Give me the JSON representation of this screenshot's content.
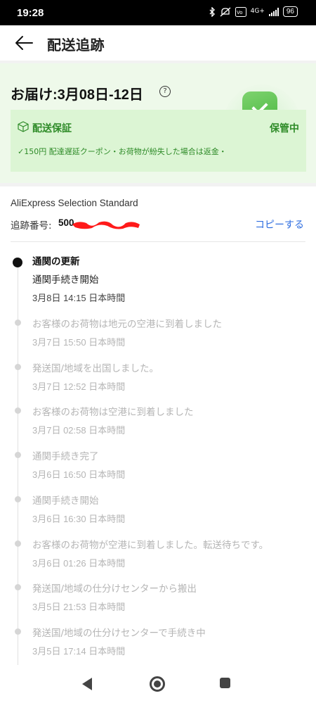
{
  "status_bar": {
    "time": "19:28",
    "network": "4G+",
    "battery": "96",
    "icons": [
      "bluetooth-icon",
      "mute-icon",
      "volte-icon",
      "signal-icon",
      "battery-icon"
    ]
  },
  "header": {
    "title": "配送追跡",
    "back_icon": "arrow-left-icon"
  },
  "delivery": {
    "eta": "お届け:3月08日-12日",
    "help_icon": "?",
    "guarantee_label": "配送保証",
    "guarantee_status": "保管中",
    "guarantee_note": "✓150円 配達遅延クーポン・お荷物が紛失した場合は返金・",
    "accent_color": "#2e8b28"
  },
  "tracking": {
    "carrier": "AliExpress Selection Standard",
    "number_label": "追跡番号:",
    "number_visible": "500",
    "copy_label": "コピーする",
    "events": [
      {
        "title": "通関の更新",
        "subtitle": "通関手続き開始",
        "time": "3月8日 14:15 日本時間",
        "active": true
      },
      {
        "title": "お客様のお荷物は地元の空港に到着しました",
        "time": "3月7日 15:50 日本時間"
      },
      {
        "title": "発送国/地域を出国しました。",
        "time": "3月7日 12:52 日本時間"
      },
      {
        "title": "お客様のお荷物は空港に到着しました",
        "time": "3月7日 02:58 日本時間"
      },
      {
        "title": "通関手続き完了",
        "time": "3月6日 16:50 日本時間"
      },
      {
        "title": "通関手続き開始",
        "time": "3月6日 16:30 日本時間"
      },
      {
        "title": "お客様のお荷物が空港に到着しました。転送待ちです。",
        "time": "3月6日 01:26 日本時間"
      },
      {
        "title": "発送国/地域の仕分けセンターから搬出",
        "time": "3月5日 21:53 日本時間"
      },
      {
        "title": "発送国/地域の仕分けセンターで手続き中",
        "time": "3月5日 17:14 日本時間"
      }
    ]
  }
}
